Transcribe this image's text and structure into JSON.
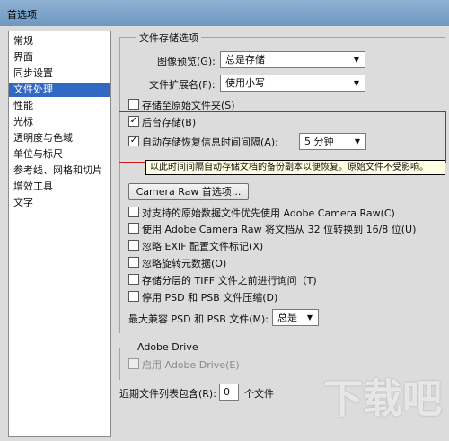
{
  "window": {
    "title": "首选项"
  },
  "sidebar": {
    "items": [
      {
        "label": "常规"
      },
      {
        "label": "界面"
      },
      {
        "label": "同步设置"
      },
      {
        "label": "文件处理"
      },
      {
        "label": "性能"
      },
      {
        "label": "光标"
      },
      {
        "label": "透明度与色域"
      },
      {
        "label": "单位与标尺"
      },
      {
        "label": "参考线、网格和切片"
      },
      {
        "label": "增效工具"
      },
      {
        "label": "文字"
      }
    ],
    "selected_index": 3
  },
  "file_save": {
    "group_title": "文件存储选项",
    "image_preview_label": "图像预览(G):",
    "image_preview_value": "总是存储",
    "ext_label": "文件扩展名(F):",
    "ext_value": "使用小写",
    "save_original_folder": {
      "label": "存储至原始文件夹(S)",
      "checked": false
    },
    "background_save": {
      "label": "后台存储(B)",
      "checked": true
    },
    "auto_recover": {
      "label": "自动存储恢复信息时间间隔(A):",
      "checked": true,
      "value": "5 分钟"
    },
    "tooltip": "以此时间间隔自动存储文档的备份副本以便恢复。原始文件不受影响。"
  },
  "compat": {
    "camera_raw_button": "Camera Raw 首选项...",
    "options": [
      {
        "label": "对支持的原始数据文件优先使用 Adobe Camera Raw(C)",
        "checked": false
      },
      {
        "label": "使用 Adobe Camera Raw 将文档从 32 位转换到 16/8 位(U)",
        "checked": false
      },
      {
        "label": "忽略 EXIF 配置文件标记(X)",
        "checked": false
      },
      {
        "label": "忽略旋转元数据(O)",
        "checked": false
      },
      {
        "label": "存储分层的 TIFF 文件之前进行询问（T)",
        "checked": false
      },
      {
        "label": "停用 PSD 和 PSB 文件压缩(D)",
        "checked": false
      }
    ],
    "max_compat_label": "最大兼容 PSD 和 PSB 文件(M):",
    "max_compat_value": "总是"
  },
  "adobe_drive": {
    "group_title": "Adobe Drive",
    "enable": {
      "label": "启用 Adobe Drive(E)",
      "checked": false,
      "disabled": true
    }
  },
  "recent": {
    "label": "近期文件列表包含(R):",
    "value": "0",
    "suffix": "个文件"
  },
  "watermark": "下载吧",
  "icons": {
    "check": "check-icon",
    "dropdown": "dropdown-arrow-icon"
  }
}
